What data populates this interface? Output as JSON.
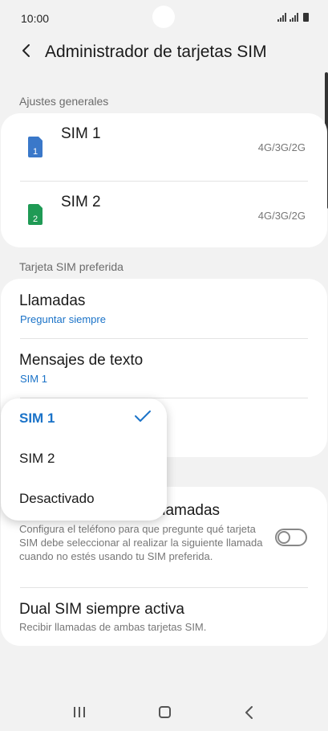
{
  "status_bar": {
    "time": "10:00"
  },
  "header": {
    "title": "Administrador de tarjetas SIM"
  },
  "general": {
    "section_label": "Ajustes generales",
    "sims": [
      {
        "name": "SIM 1",
        "number": "1",
        "network": "4G/3G/2G",
        "color": "#3a78c9"
      },
      {
        "name": "SIM 2",
        "number": "2",
        "network": "4G/3G/2G",
        "color": "#1f9a55"
      }
    ]
  },
  "preferred": {
    "section_label": "Tarjeta SIM preferida",
    "calls": {
      "title": "Llamadas",
      "value": "Preguntar siempre"
    },
    "messages": {
      "title": "Mensajes de texto",
      "value": "SIM 1"
    }
  },
  "dropdown": {
    "options": [
      {
        "label": "SIM 1",
        "selected": true
      },
      {
        "label": "SIM 2",
        "selected": false
      },
      {
        "label": "Desactivado",
        "selected": false
      }
    ]
  },
  "ask": {
    "title_visible": "llamadas",
    "description": "Configura el teléfono para que pregunte qué tarjeta SIM debe seleccionar al realizar la siguiente llamada cuando no estés usando tu SIM preferida.",
    "toggle_on": false
  },
  "dual": {
    "title": "Dual SIM siempre activa",
    "description": "Recibir llamadas de ambas tarjetas SIM."
  },
  "colors": {
    "accent": "#1b73c8",
    "background": "#f2f2f2",
    "card": "#ffffff"
  }
}
